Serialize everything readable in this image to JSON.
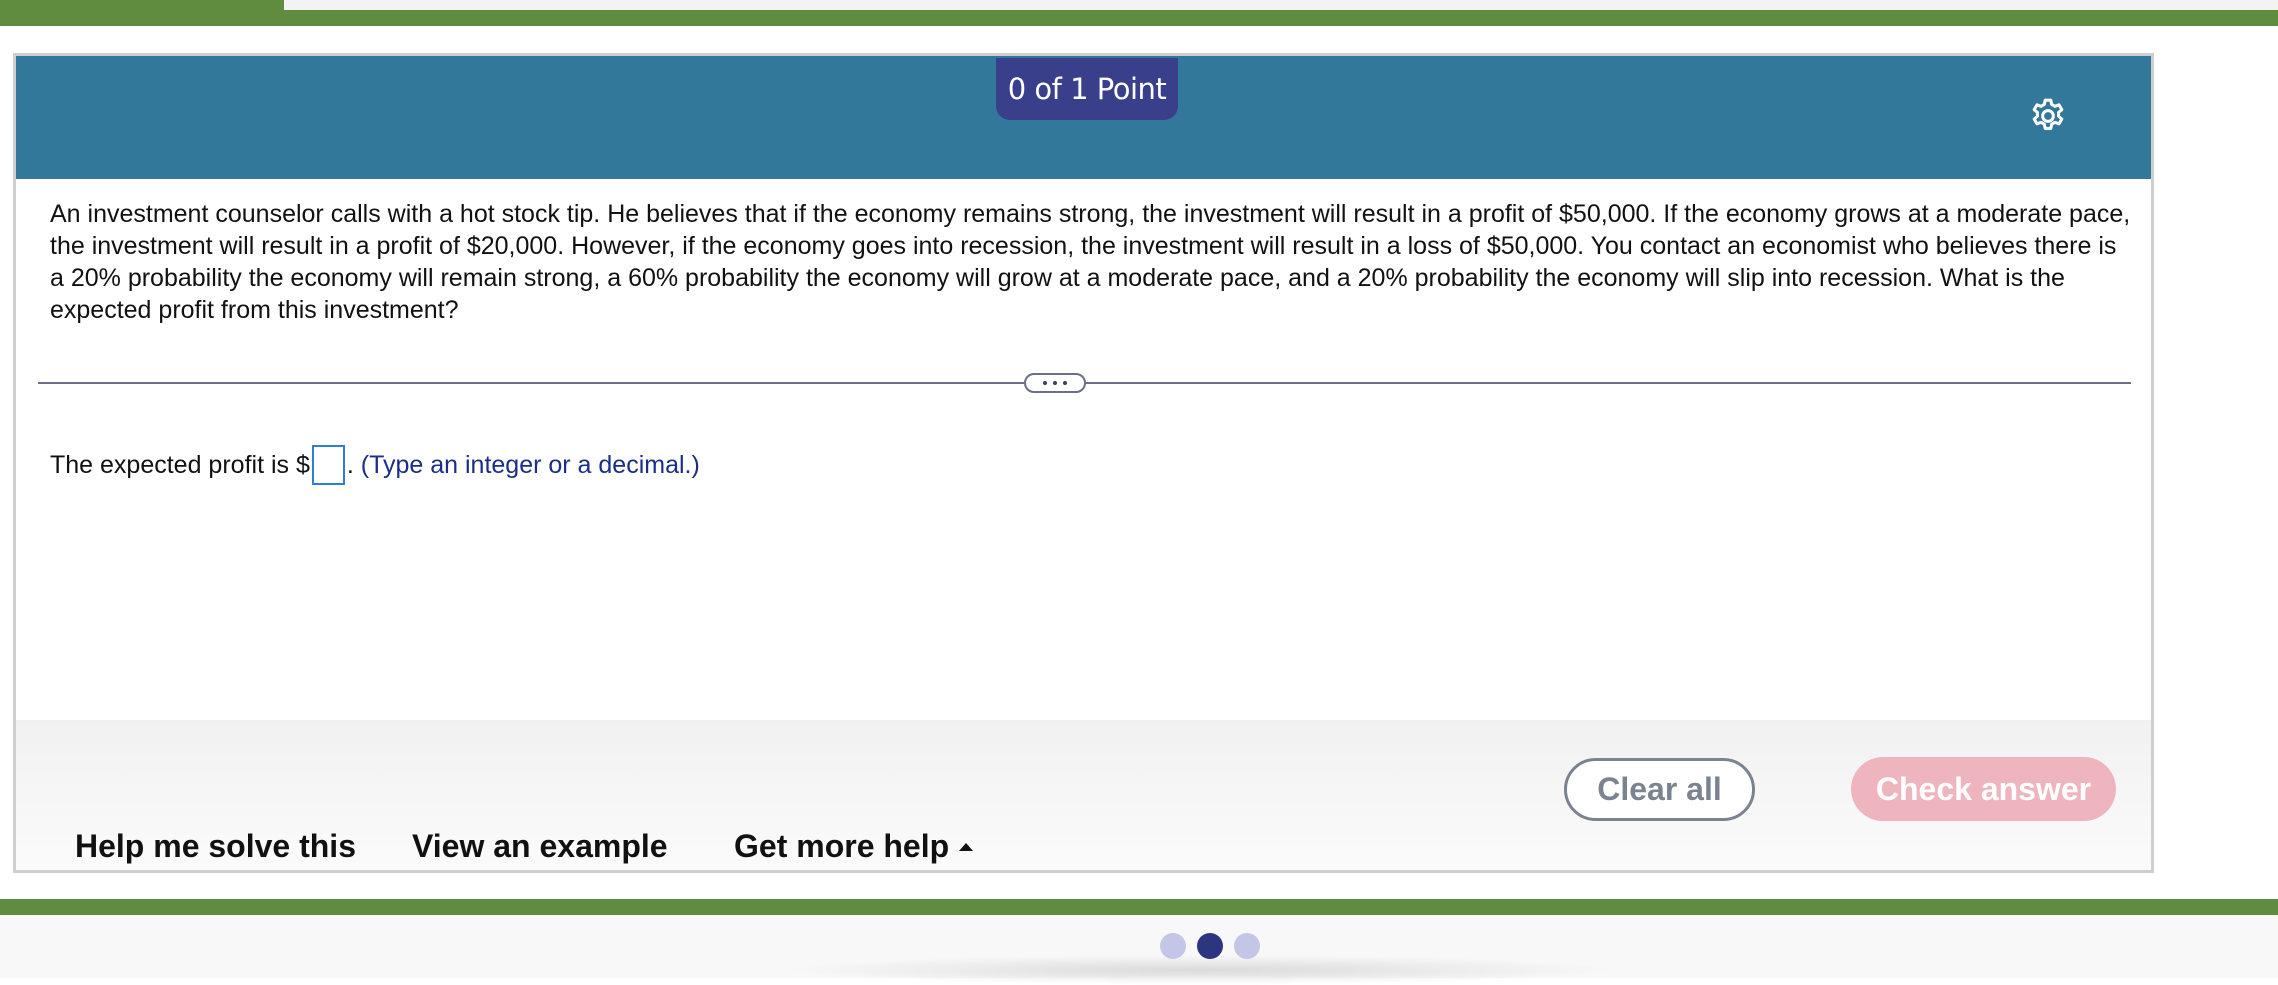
{
  "header": {
    "points": "0 of 1 Point",
    "settings_icon": "gear-icon",
    "color": "#31789a",
    "points_color": "#3a3f8c"
  },
  "question": {
    "text": "An investment counselor calls with a hot stock tip. He believes that if the economy remains strong, the investment will result in a profit of $50,000. If the economy grows at a moderate pace, the investment will result in a profit of $20,000. However, if the economy goes into recession, the investment will result in a loss of $50,000. You contact an economist who believes there is a 20% probability the economy will remain strong, a 60% probability the economy will grow at a moderate pace, and a 20% probability the economy will slip into recession. What is the expected profit from this investment?"
  },
  "answer": {
    "prefix": "The expected profit is $",
    "input_value": "",
    "suffix": ".",
    "hint": " (Type an integer or a decimal.)"
  },
  "footer": {
    "help_me_solve": "Help me solve this",
    "view_example": "View an example",
    "get_more_help": "Get more help",
    "clear_all": "Clear all",
    "check_answer": "Check answer",
    "check_answer_color": "#efb5bf"
  },
  "pagination": {
    "dot_count": 3,
    "active_index": 1
  },
  "colors": {
    "top_bar": "#5f8c3e"
  }
}
